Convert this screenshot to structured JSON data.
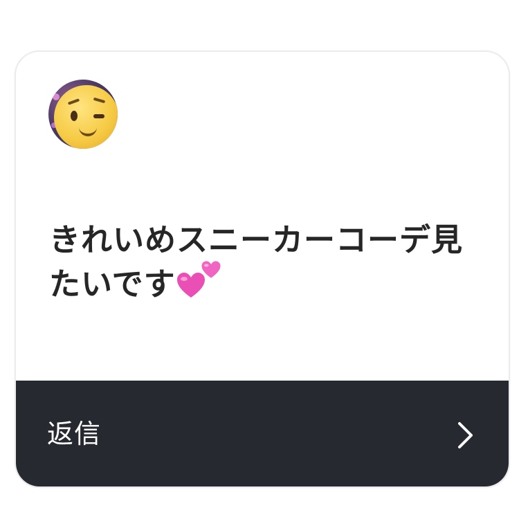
{
  "card": {
    "message": "きれいめスニーカーコーデ見たいです",
    "reaction_emoji": "two-hearts-icon",
    "reply_label": "返信",
    "avatar_icon": "winking-face-avatar"
  },
  "colors": {
    "reply_bar_bg": "#262a30",
    "text_dark": "#262626",
    "heart_pink": "#e94fb4"
  }
}
